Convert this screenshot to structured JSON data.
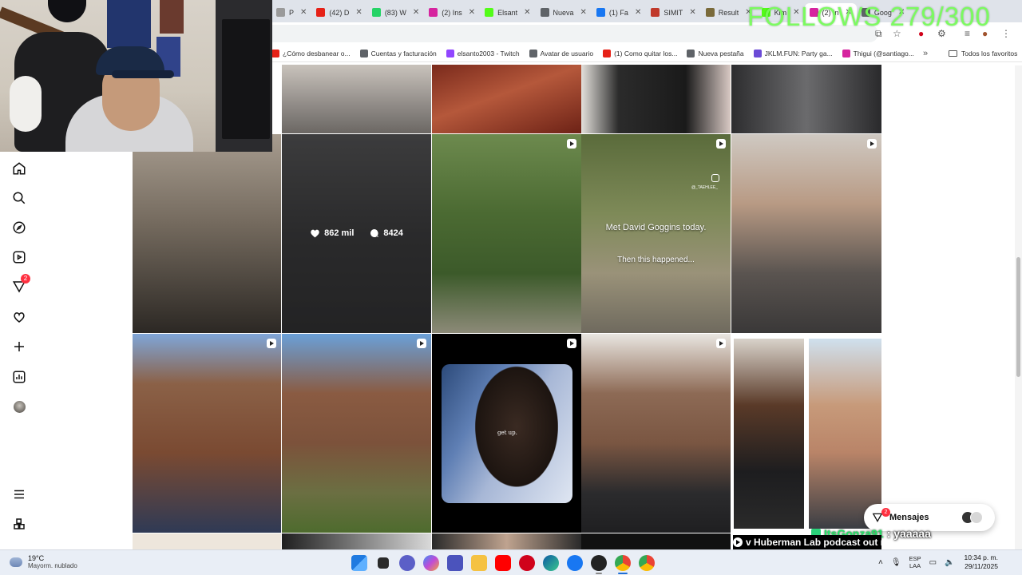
{
  "overlay": {
    "follows_goal": "FOLLOWS 279/300"
  },
  "browser": {
    "tabs": [
      {
        "label": "P",
        "color": "#9a9a9a"
      },
      {
        "label": "(42) D",
        "color": "#e62117"
      },
      {
        "label": "(83) W",
        "color": "#25d366"
      },
      {
        "label": "(2) Ins",
        "color": "#d6249f"
      },
      {
        "label": "Elsant",
        "color": "#53fc18"
      },
      {
        "label": "Nueva",
        "color": "#5f6368"
      },
      {
        "label": "(1) Fa",
        "color": "#1877f2"
      },
      {
        "label": "SIMIT",
        "color": "#c0392b"
      },
      {
        "label": "Result",
        "color": "#7a6a3a"
      },
      {
        "label": "Kim",
        "color": "#53fc18"
      },
      {
        "label": "(2) In",
        "color": "#d6249f",
        "active": true
      },
      {
        "label": "Goog",
        "color": "#5f6368"
      }
    ],
    "bookmarks": [
      {
        "label": "¿Cómo desbanear o...",
        "color": "#e62117"
      },
      {
        "label": "Cuentas y facturación",
        "color": "#5f6368"
      },
      {
        "label": "elsanto2003 - Twitch",
        "color": "#9146ff"
      },
      {
        "label": "Avatar de usuario",
        "color": "#5f6368"
      },
      {
        "label": "(1) Como quitar los...",
        "color": "#e62117"
      },
      {
        "label": "Nueva pestaña",
        "color": "#5f6368"
      },
      {
        "label": "JKLM.FUN: Party ga...",
        "color": "#6b4bd6"
      },
      {
        "label": "Thigui (@santiago...",
        "color": "#d6249f"
      }
    ],
    "bookmarks_more": "»",
    "all_bookmarks": "Todos los favoritos"
  },
  "sidebar": {
    "notifications_count": "2"
  },
  "posts": {
    "p5_likes": "862 mil",
    "p5_comments": "8424",
    "p7_caption_1": "Met David Goggins today.",
    "p7_caption_2": "Then this happened...",
    "p7_watermark": "@_TAEHLEE_",
    "p11_text": "get up."
  },
  "messages": {
    "label": "Mensajes",
    "badge": "2"
  },
  "chat": {
    "user": "ItsGonza91",
    "message": ": yaaaaa"
  },
  "ticker": {
    "text": "v Huberman Lab podcast out n"
  },
  "taskbar": {
    "temperature": "19°C",
    "weather": "Mayorm. nublado",
    "lang_1": "ESP",
    "lang_2": "LAA",
    "time": "10:34 p. m.",
    "date": "29/11/2025"
  }
}
